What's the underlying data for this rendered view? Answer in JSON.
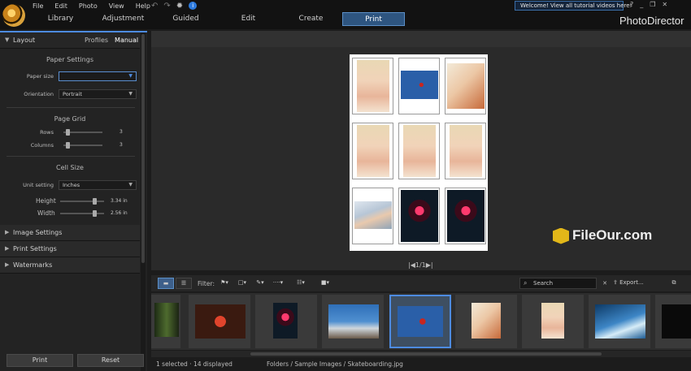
{
  "app": {
    "brand": "PhotoDirector",
    "welcome": "Welcome! View all tutorial videos here!"
  },
  "menu": [
    "File",
    "Edit",
    "Photo",
    "View",
    "Help"
  ],
  "tabs": [
    "Library",
    "Adjustment",
    "Guided",
    "Edit",
    "Create",
    "Print"
  ],
  "active_tab": "Print",
  "window_controls": [
    "?",
    "_",
    "❐",
    "✕"
  ],
  "left": {
    "layout": {
      "title": "Layout",
      "subtabs": [
        "Profiles",
        "Manual"
      ],
      "selected_subtab": "Manual"
    },
    "paper_settings": {
      "title": "Paper Settings",
      "paper_size_label": "Paper size",
      "paper_size_value": "",
      "orientation_label": "Orientation",
      "orientation_value": "Portrait"
    },
    "page_grid": {
      "title": "Page Grid",
      "rows_label": "Rows",
      "rows_value": "3",
      "columns_label": "Columns",
      "columns_value": "3"
    },
    "cell_size": {
      "title": "Cell Size",
      "unit_label": "Unit setting",
      "unit_value": "Inches",
      "height_label": "Height",
      "height_value": "3.34 in",
      "width_label": "Width",
      "width_value": "2.56 in"
    },
    "sections": [
      "Image Settings",
      "Print Settings",
      "Watermarks"
    ],
    "buttons": {
      "print": "Print",
      "reset": "Reset"
    }
  },
  "preview": {
    "pager": "|◀1/1▶|"
  },
  "filmstrip_toolbar": {
    "filter_label": "Filter:",
    "search_placeholder": "Search",
    "export_label": "Export..."
  },
  "status": {
    "selection": "1 selected · 14 displayed",
    "path": "Folders / Sample Images / Skateboarding.jpg"
  },
  "watermark": "FileOur.com",
  "colors": {
    "accent": "#4d8be0",
    "active_tab": "#2e5580"
  }
}
